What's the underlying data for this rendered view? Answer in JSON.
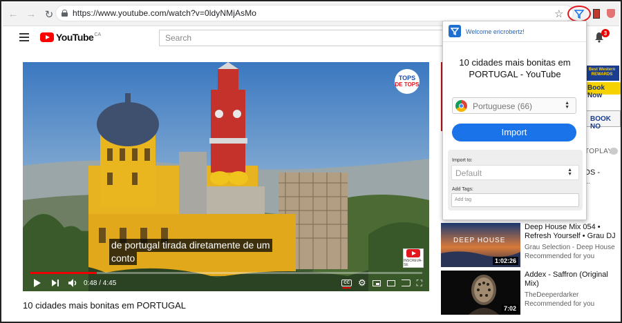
{
  "browser": {
    "url": "https://www.youtube.com/watch?v=0ldyNMjAsMo"
  },
  "youtube": {
    "logo_text": "YouTube",
    "logo_region": "CA",
    "search_placeholder": "Search",
    "notification_count": "3"
  },
  "video": {
    "channel_logo_line1": "TOPS",
    "channel_logo_line2": "DE TOPS",
    "subtitle_line1": "de portugal tirada diretamente de um",
    "subtitle_line2": "conto",
    "subscribe_label": "INSCREVA-SE",
    "time": "0:48 / 4:45",
    "progress": 0.17,
    "title": "10 cidades mais bonitas em PORTUGAL"
  },
  "ad": {
    "brand": "Best Western REWARDS",
    "cta": "Book Now",
    "cta2": "BOOK NO"
  },
  "sidebar": {
    "autoplay_label": "TOPLAY",
    "partial_title": "DS -",
    "partial_meta": "..."
  },
  "recommendations": [
    {
      "title": "Deep House Mix 054 • Refresh Yourself • Grau DJ",
      "channel": "Grau Selection - Deep House",
      "meta": "Recommended for you",
      "duration": "1:02:26",
      "thumb_text": "DEEP HOUSE"
    },
    {
      "title": "Addex - Saffron (Original Mix)",
      "channel": "TheDeeperdarker",
      "meta": "Recommended for you",
      "duration": "7:02"
    }
  ],
  "popup": {
    "welcome": "Welcome ericrobertz!",
    "title": "10 cidades mais bonitas em PORTUGAL - YouTube",
    "language": "Portuguese (66)",
    "import_button": "Import",
    "import_to_label": "Import to:",
    "destination": "Default",
    "add_tags_label": "Add Tags:",
    "tag_placeholder": "Add tag"
  },
  "colors": {
    "youtube_red": "#ff0000",
    "popup_blue": "#1a73e8",
    "highlight_circle": "#e3161d"
  }
}
